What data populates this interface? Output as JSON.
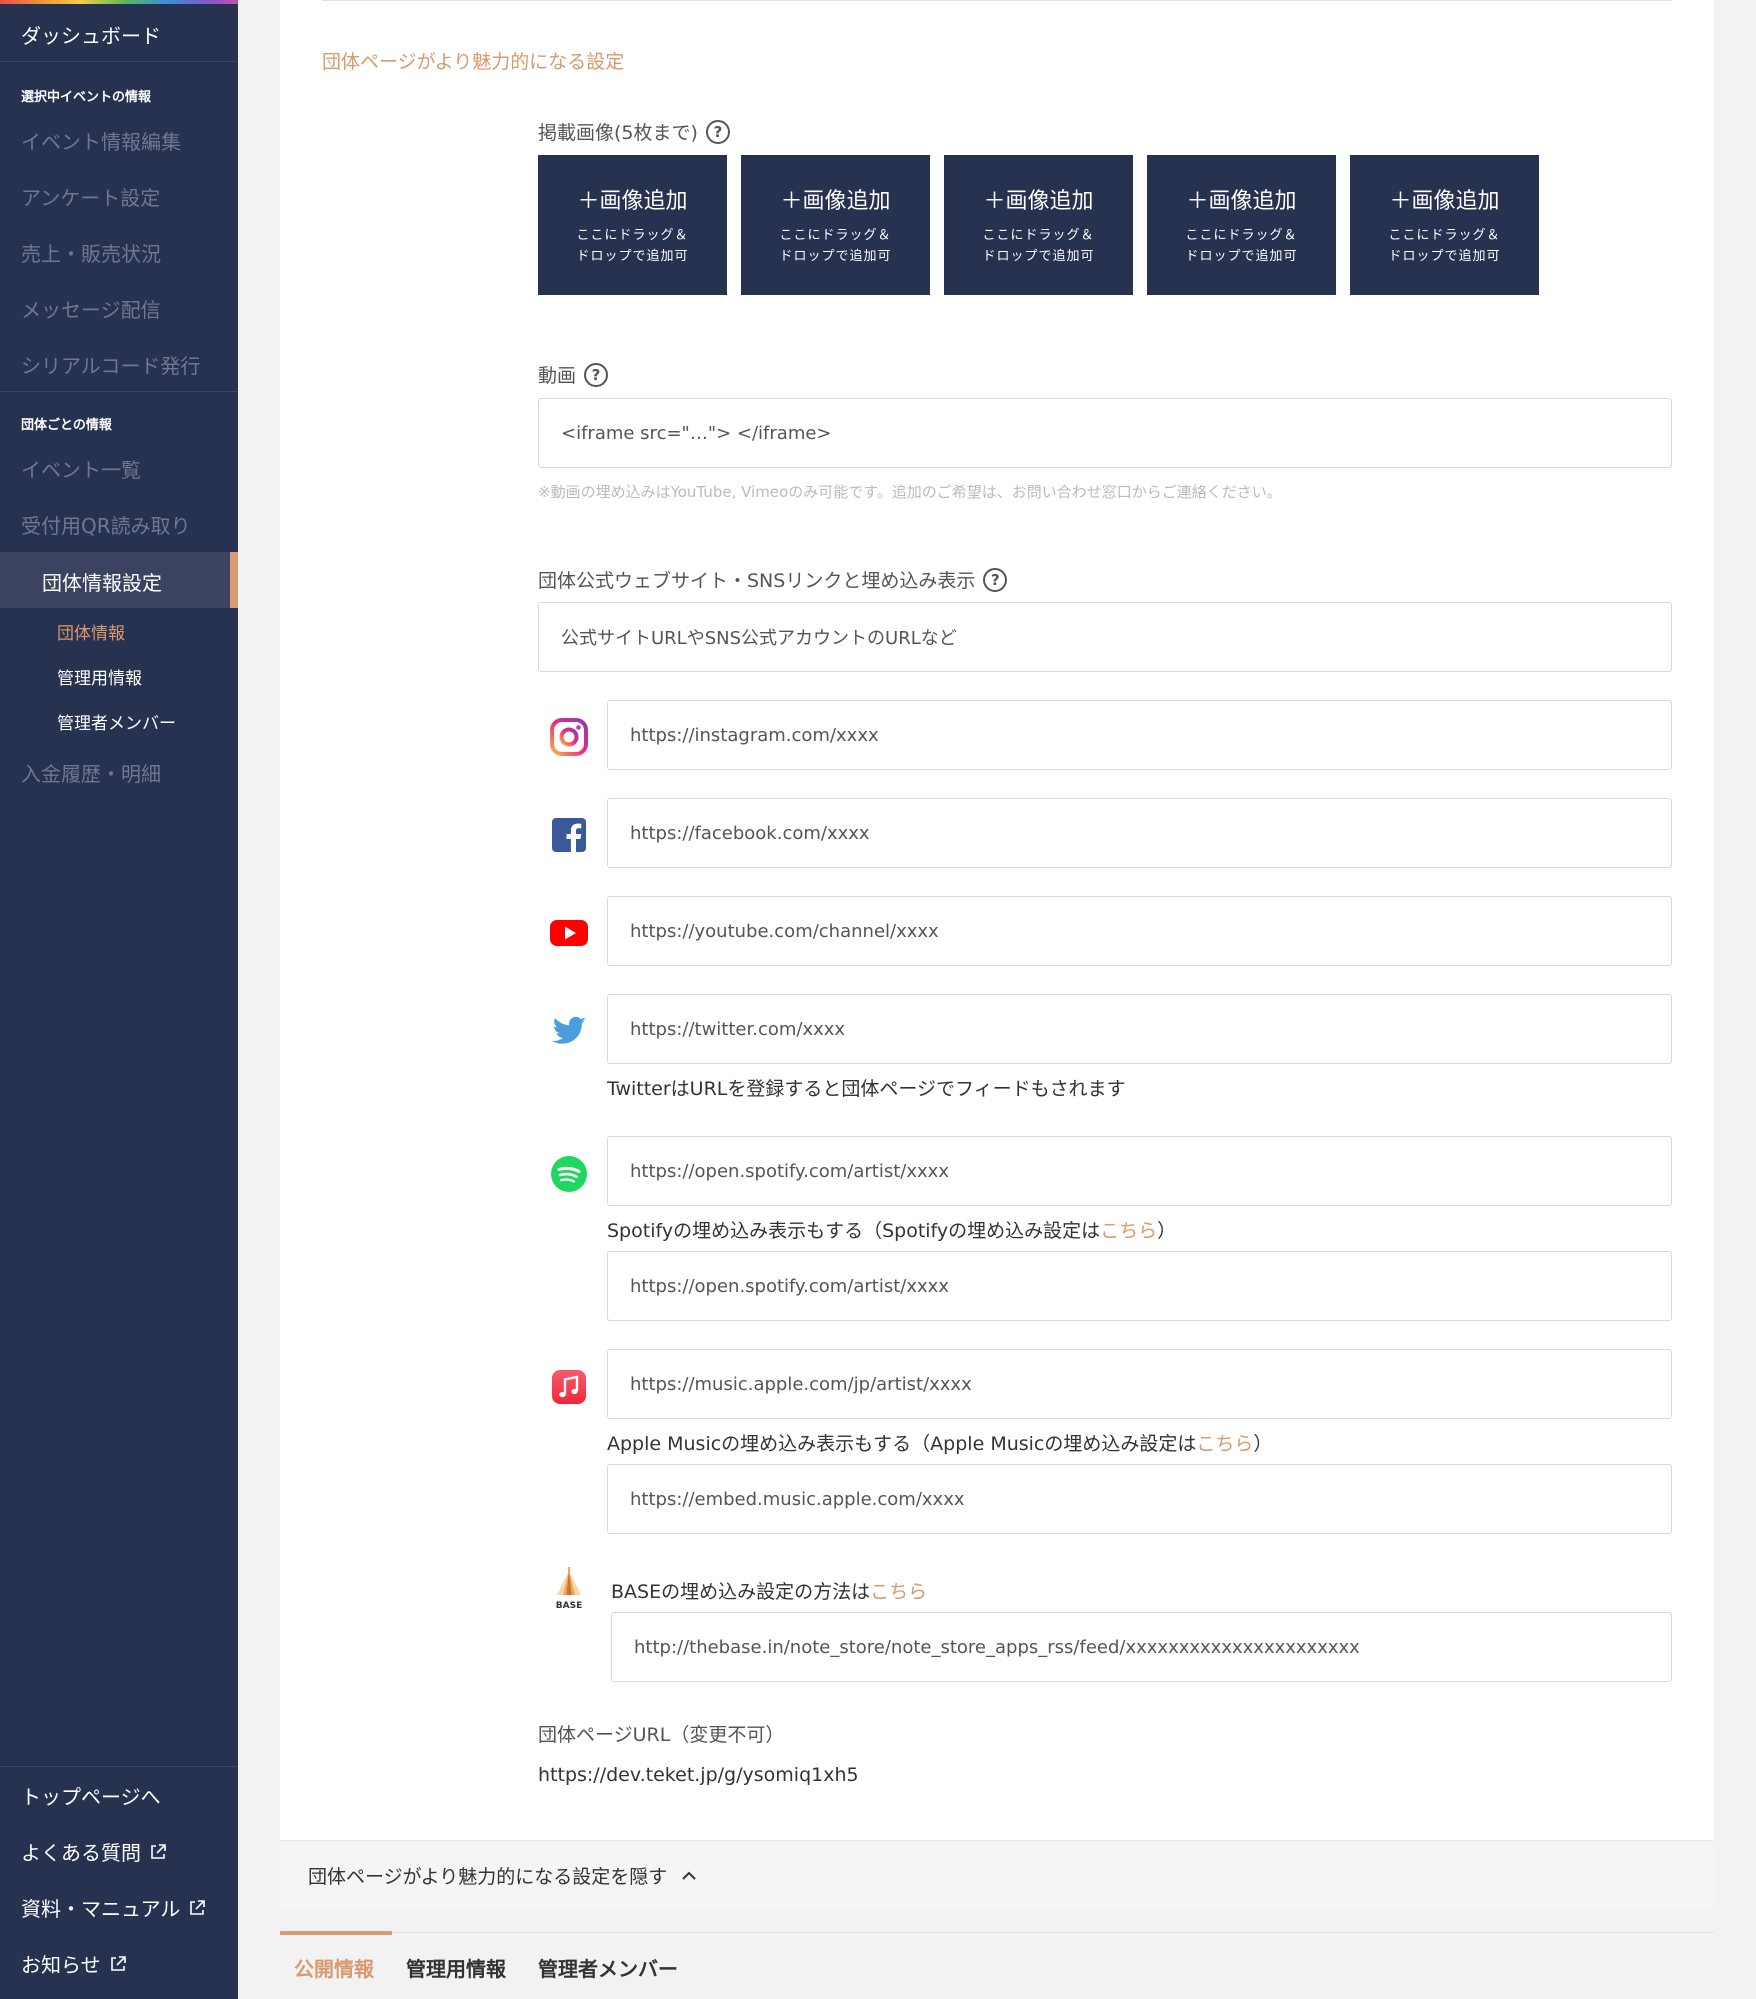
{
  "sidebar": {
    "dashboard": "ダッシュボード",
    "section_event": "選択中イベントの情報",
    "event_items": [
      "イベント情報編集",
      "アンケート設定",
      "売上・販売状況",
      "メッセージ配信",
      "シリアルコード発行"
    ],
    "section_org": "団体ごとの情報",
    "org_items": [
      "イベント一覧",
      "受付用QR読み取り"
    ],
    "active_item": "団体情報設定",
    "sub_items": [
      "団体情報",
      "管理用情報",
      "管理者メンバー"
    ],
    "after_item": "入金履歴・明細",
    "footer": [
      "トップページへ",
      "よくある質問",
      "資料・マニュアル",
      "お知らせ"
    ]
  },
  "section_title": "団体ページがより魅力的になる設定",
  "images": {
    "label": "掲載画像(5枚まで)",
    "tiles": [
      {
        "title": "＋画像追加",
        "line1": "ここにドラッグ＆",
        "line2": "ドロップで追加可"
      },
      {
        "title": "＋画像追加",
        "line1": "ここにドラッグ＆",
        "line2": "ドロップで追加可"
      },
      {
        "title": "＋画像追加",
        "line1": "ここにドラッグ＆",
        "line2": "ドロップで追加可"
      },
      {
        "title": "＋画像追加",
        "line1": "ここにドラッグ＆",
        "line2": "ドロップで追加可"
      },
      {
        "title": "＋画像追加",
        "line1": "ここにドラッグ＆",
        "line2": "ドロップで追加可"
      }
    ]
  },
  "video": {
    "label": "動画",
    "placeholder": "<iframe src=\"…\"> </iframe>",
    "note": "※動画の埋め込みはYouTube, Vimeoのみ可能です。追加のご希望は、お問い合わせ窓口からご連絡ください。"
  },
  "sns": {
    "label": "団体公式ウェブサイト・SNSリンクと埋め込み表示",
    "website_placeholder": "公式サイトURLやSNS公式アカウントのURLなど",
    "instagram_placeholder": "https://instagram.com/xxxx",
    "facebook_placeholder": "https://facebook.com/xxxx",
    "youtube_placeholder": "https://youtube.com/channel/xxxx",
    "twitter_placeholder": "https://twitter.com/xxxx",
    "twitter_note": "TwitterはURLを登録すると団体ページでフィードもされます",
    "spotify_placeholder": "https://open.spotify.com/artist/xxxx",
    "spotify_note_prefix": "Spotifyの埋め込み表示もする（Spotifyの埋め込み設定は",
    "spotify_note_link": "こちら",
    "spotify_note_suffix": "）",
    "spotify_embed_placeholder": "https://open.spotify.com/artist/xxxx",
    "apple_placeholder": "https://music.apple.com/jp/artist/xxxx",
    "apple_note_prefix": "Apple Musicの埋め込み表示もする（Apple Musicの埋め込み設定は",
    "apple_note_link": "こちら",
    "apple_note_suffix": "）",
    "apple_embed_placeholder": "https://embed.music.apple.com/xxxx",
    "base_note_prefix": "BASEの埋め込み設定の方法は",
    "base_note_link": "こちら",
    "base_icon_text": "BASE",
    "base_placeholder": "http://thebase.in/note_store/note_store_apps_rss/feed/xxxxxxxxxxxxxxxxxxxxxx"
  },
  "page_url": {
    "label": "団体ページURL（変更不可）",
    "value": "https://dev.teket.jp/g/ysomiq1xh5"
  },
  "collapse_label": "団体ページがより魅力的になる設定を隠す",
  "tabs": [
    "公開情報",
    "管理用情報",
    "管理者メンバー"
  ],
  "colors": {
    "sidebar_bg": "#273150",
    "accent": "#d89a6e",
    "tile_bg": "#273150"
  }
}
